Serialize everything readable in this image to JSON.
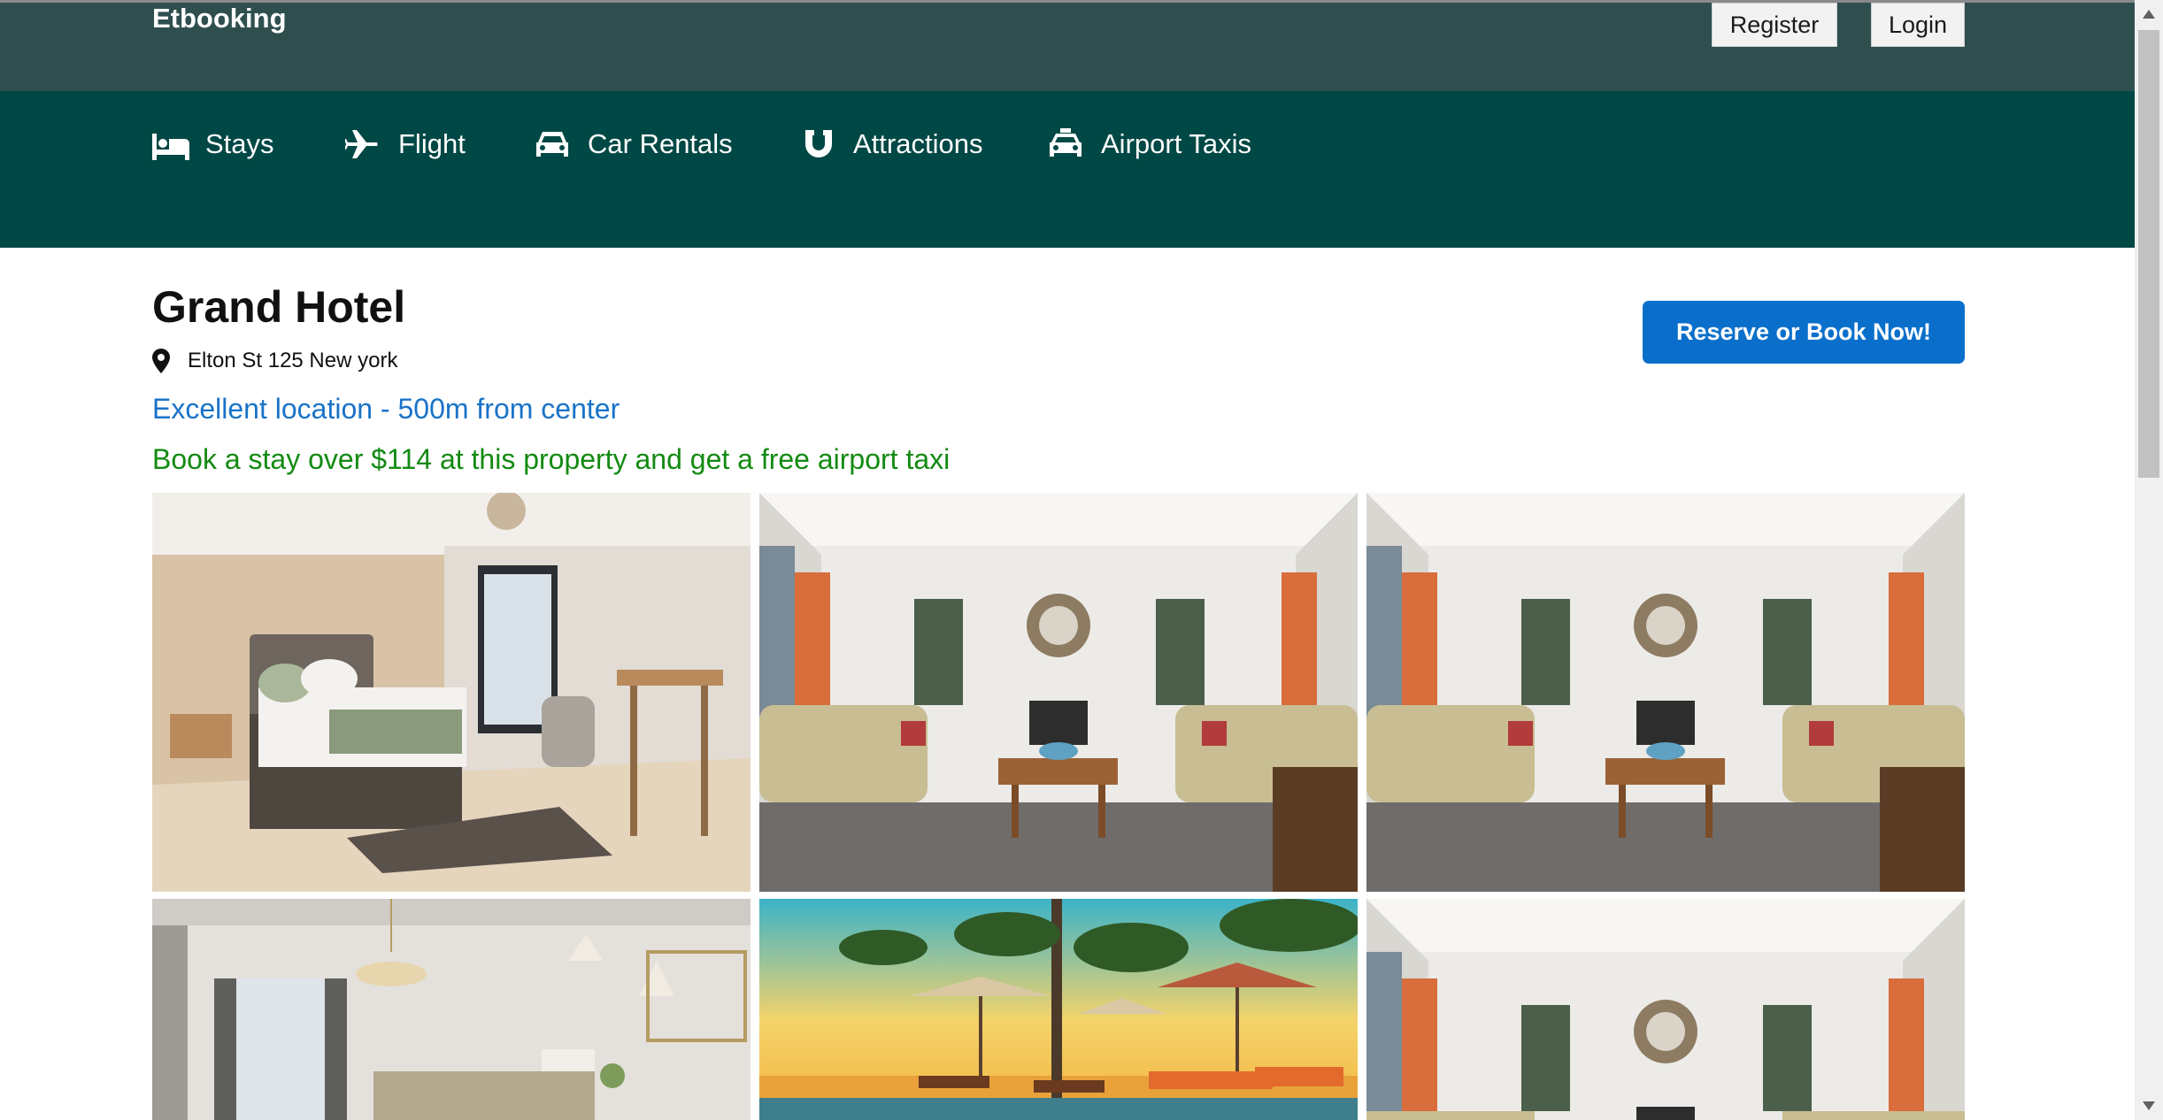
{
  "header": {
    "logo": "Etbooking",
    "register_label": "Register",
    "login_label": "Login"
  },
  "nav": {
    "items": [
      {
        "label": "Stays",
        "icon": "bed-icon"
      },
      {
        "label": "Flight",
        "icon": "plane-icon"
      },
      {
        "label": "Car Rentals",
        "icon": "car-icon"
      },
      {
        "label": "Attractions",
        "icon": "magnet-icon"
      },
      {
        "label": "Airport Taxis",
        "icon": "taxi-icon"
      }
    ]
  },
  "hotel": {
    "name": "Grand Hotel",
    "address": "Elton St 125 New york",
    "location_note": "Excellent location - 500m from center",
    "promo": "Book a stay over $114 at this property and get a free airport taxi",
    "reserve_label": "Reserve or Book Now!"
  },
  "photos": [
    {
      "subject": "bedroom"
    },
    {
      "subject": "living-room"
    },
    {
      "subject": "living-room"
    },
    {
      "subject": "lounge-with-chandelier"
    },
    {
      "subject": "beach-resort-umbrellas"
    },
    {
      "subject": "living-room"
    }
  ],
  "colors": {
    "topbar": "#2f4f4f",
    "navband": "#004845",
    "reserve_button": "#0a6fcb",
    "location_text": "#1a73c8",
    "promo_text": "#138a12"
  }
}
